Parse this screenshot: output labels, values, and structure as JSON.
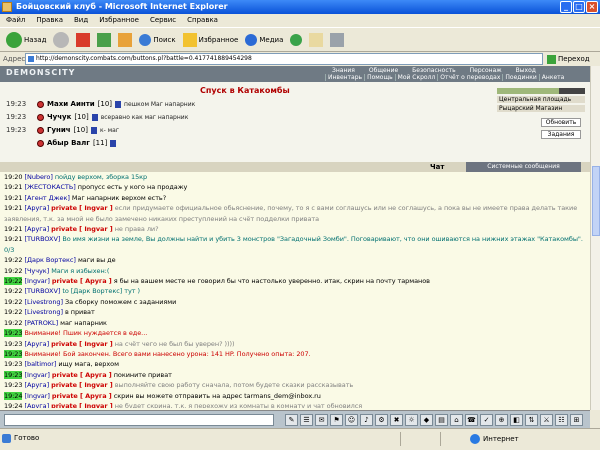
{
  "window": {
    "title": "Бойцовский клуб - Microsoft Internet Explorer"
  },
  "menu": [
    "Файл",
    "Правка",
    "Вид",
    "Избранное",
    "Сервис",
    "Справка"
  ],
  "toolbar": {
    "back": "Назад",
    "search": "Поиск",
    "favorites": "Избранное",
    "media": "Медиа"
  },
  "address": {
    "label": "Адрес:",
    "url": "http://demonscity.combats.com/buttons.pl?battle=0.417741889454298",
    "go": "Переход"
  },
  "game": {
    "logo": "DEMONSCITY",
    "nav_top": [
      "Знания",
      "Общение",
      "Безопасность",
      "Персонаж",
      "Выход"
    ],
    "nav_bottom": [
      "Инвентарь",
      "Помощь",
      "Мой Скролл",
      "Отчёт о переводах",
      "Поединки",
      "Анкета"
    ],
    "battle_title": "Спуск в Катакомбы",
    "fighters": [
      {
        "time": "19:23",
        "name": "Махи Аинти",
        "level": "[10]",
        "action": "пешком Маг напарник"
      },
      {
        "time": "19:23",
        "name": "Чучук",
        "level": "[10]",
        "action": "всеравно как маг напарник"
      },
      {
        "time": "19:23",
        "name": "Гунич",
        "level": "[10]",
        "action": "к- маг"
      },
      {
        "time": "",
        "name": "Абыр Валг",
        "level": "[11]",
        "action": ""
      }
    ],
    "side_links": [
      "Центральная площадь",
      "Рыцарский Магазин"
    ],
    "side_buttons": {
      "refresh": "Обновить",
      "tasks": "Задания"
    },
    "tabs": {
      "chat": "Чат",
      "system": "Системные сообщения"
    }
  },
  "chat": [
    {
      "time": "19:20",
      "hl": false,
      "nick": "[Nubero]",
      "priv": "",
      "text": "пойду верхом, зборка 15кр",
      "style": "msg-green"
    },
    {
      "time": "19:21",
      "hl": false,
      "nick": "[ЖЕСТОКАСТЬ]",
      "priv": "",
      "text": "пропусс есть у кого на продажу",
      "style": "msg"
    },
    {
      "time": "19:21",
      "hl": false,
      "nick": "[Агент Джек]",
      "priv": "",
      "text": "Маг напарник верхом есть?",
      "style": "msg"
    },
    {
      "time": "19:21",
      "hl": false,
      "nick": "[Аруга]",
      "priv": "private [ Ingvar ]",
      "text": "если придумаете официальное обьяснение, почему, то я с вами соглашусь или не соглашусь, а пока вы не имеете права делать такие заявления, т.к. за мной не было замечено никаких преступлений на счёт подделки привата",
      "style": "msg-gray",
      "wrap": true
    },
    {
      "time": "19:21",
      "hl": false,
      "nick": "[Аруга]",
      "priv": "private [ Ingvar ]",
      "text": "не права ли?",
      "style": "msg-gray"
    },
    {
      "time": "19:21",
      "hl": false,
      "nick": "[TURBOXV]",
      "priv": "",
      "text": "Во имя жизни на земле, Вы должны найти и убить 3 монстров \"Загадочный Зомби\". Поговаривают, что они ошиваются на нижних этажах \"Катакомбы\". 0/3",
      "style": "msg-green",
      "wrap": true
    },
    {
      "time": "19:22",
      "hl": false,
      "nick": "[Дарк Вортекс]",
      "priv": "",
      "text": "маги вы де",
      "style": "msg"
    },
    {
      "time": "19:22",
      "hl": false,
      "nick": "[Чучук]",
      "priv": "",
      "text": "Маги я избыхен:(",
      "style": "msg-green"
    },
    {
      "time": "19:22",
      "hl": true,
      "nick": "[Ingvar]",
      "priv": "private [ Аруга ]",
      "text": "я бы на вашем месте не говорил бы что настолько уверенно. итак, скрин на почту тарманов",
      "style": "msg"
    },
    {
      "time": "19:22",
      "hl": false,
      "nick": "[TURBOXV]",
      "priv": "",
      "text": "to [Дарк Вортекс] тут )",
      "style": "msg-green"
    },
    {
      "time": "19:22",
      "hl": false,
      "nick": "[Livestrong]",
      "priv": "",
      "text": "За сборку поможем с заданиями",
      "style": "msg"
    },
    {
      "time": "19:22",
      "hl": false,
      "nick": "[Livestrong]",
      "priv": "",
      "text": "в приват",
      "style": "msg"
    },
    {
      "time": "19:22",
      "hl": false,
      "nick": "[PATROKL]",
      "priv": "",
      "text": "маг напарник",
      "style": "msg"
    },
    {
      "time": "19:23",
      "hl": true,
      "nick": "",
      "priv": "",
      "text": "Внимание! Пшик нуждается в еде...",
      "style": "msg-red"
    },
    {
      "time": "19:23",
      "hl": false,
      "nick": "[Аруга]",
      "priv": "private [ Ingvar ]",
      "text": "на счёт чего не был бы уверен? ))))",
      "style": "msg-gray"
    },
    {
      "time": "19:23",
      "hl": true,
      "nick": "",
      "priv": "",
      "text": "Внимание! Бой закончен. Всего вами нанесено урона: 141 HP. Получено опыта: 207.",
      "style": "msg-red"
    },
    {
      "time": "19:23",
      "hl": false,
      "nick": "[baltimor]",
      "priv": "",
      "text": "ищу мага, верхом",
      "style": "msg"
    },
    {
      "time": "19:23",
      "hl": true,
      "nick": "[Ingvar]",
      "priv": "private [ Аруга ]",
      "text": "покините приват",
      "style": "msg"
    },
    {
      "time": "19:23",
      "hl": false,
      "nick": "[Аруга]",
      "priv": "private [ Ingvar ]",
      "text": "выполняйте свою работу сначала, потом будете сказки рассказывать",
      "style": "msg-gray"
    },
    {
      "time": "19:24",
      "hl": true,
      "nick": "[Ingvar]",
      "priv": "private [ Аруга ]",
      "text": "скрин вы можете отправить на адрес tarmans_dem@inbox.ru",
      "style": "msg"
    },
    {
      "time": "19:24",
      "hl": false,
      "nick": "[Аруга]",
      "priv": "private [ Ingvar ]",
      "text": "не будет скрина, т.к. я перехожу из комнаты в комнату и чат обновился",
      "style": "msg-gray"
    }
  ],
  "status": {
    "left": "Готово",
    "zone": "Интернет"
  }
}
